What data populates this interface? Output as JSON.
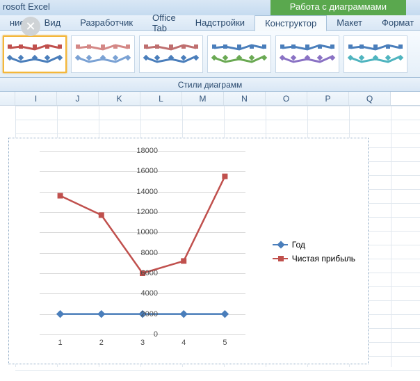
{
  "app_title": "rosoft Excel",
  "tool_tab": "Работа с диаграммами",
  "menu": {
    "items": [
      "ние",
      "Вид",
      "Разработчик",
      "Office Tab",
      "Надстройки",
      "Конструктор",
      "Макет",
      "Формат"
    ],
    "active_index": 5
  },
  "gallery_label": "Стили диаграмм",
  "columns": [
    "I",
    "J",
    "K",
    "L",
    "M",
    "N",
    "O",
    "P",
    "Q"
  ],
  "legend": {
    "s1": "Год",
    "s2": "Чистая прибыль"
  },
  "chart_data": {
    "type": "line",
    "categories": [
      1,
      2,
      3,
      4,
      5
    ],
    "series": [
      {
        "name": "Год",
        "values": [
          2000,
          2000,
          2000,
          2000,
          2000
        ],
        "color": "#4a7ebb"
      },
      {
        "name": "Чистая прибыль",
        "values": [
          13600,
          11700,
          6000,
          7200,
          15500
        ],
        "color": "#c0504d"
      }
    ],
    "ylim": [
      0,
      18000
    ],
    "ytick": 2000,
    "xlabel": "",
    "ylabel": "",
    "title": ""
  },
  "style_palettes": [
    [
      "#4a7ebb",
      "#c0504d"
    ],
    [
      "#7ba2d4",
      "#d48886"
    ],
    [
      "#4a7ebb",
      "#bf6f6f"
    ],
    [
      "#6aa953",
      "#4a7ebb"
    ],
    [
      "#8a72c4",
      "#4a7ebb"
    ],
    [
      "#4fb4bf",
      "#4a7ebb"
    ]
  ]
}
